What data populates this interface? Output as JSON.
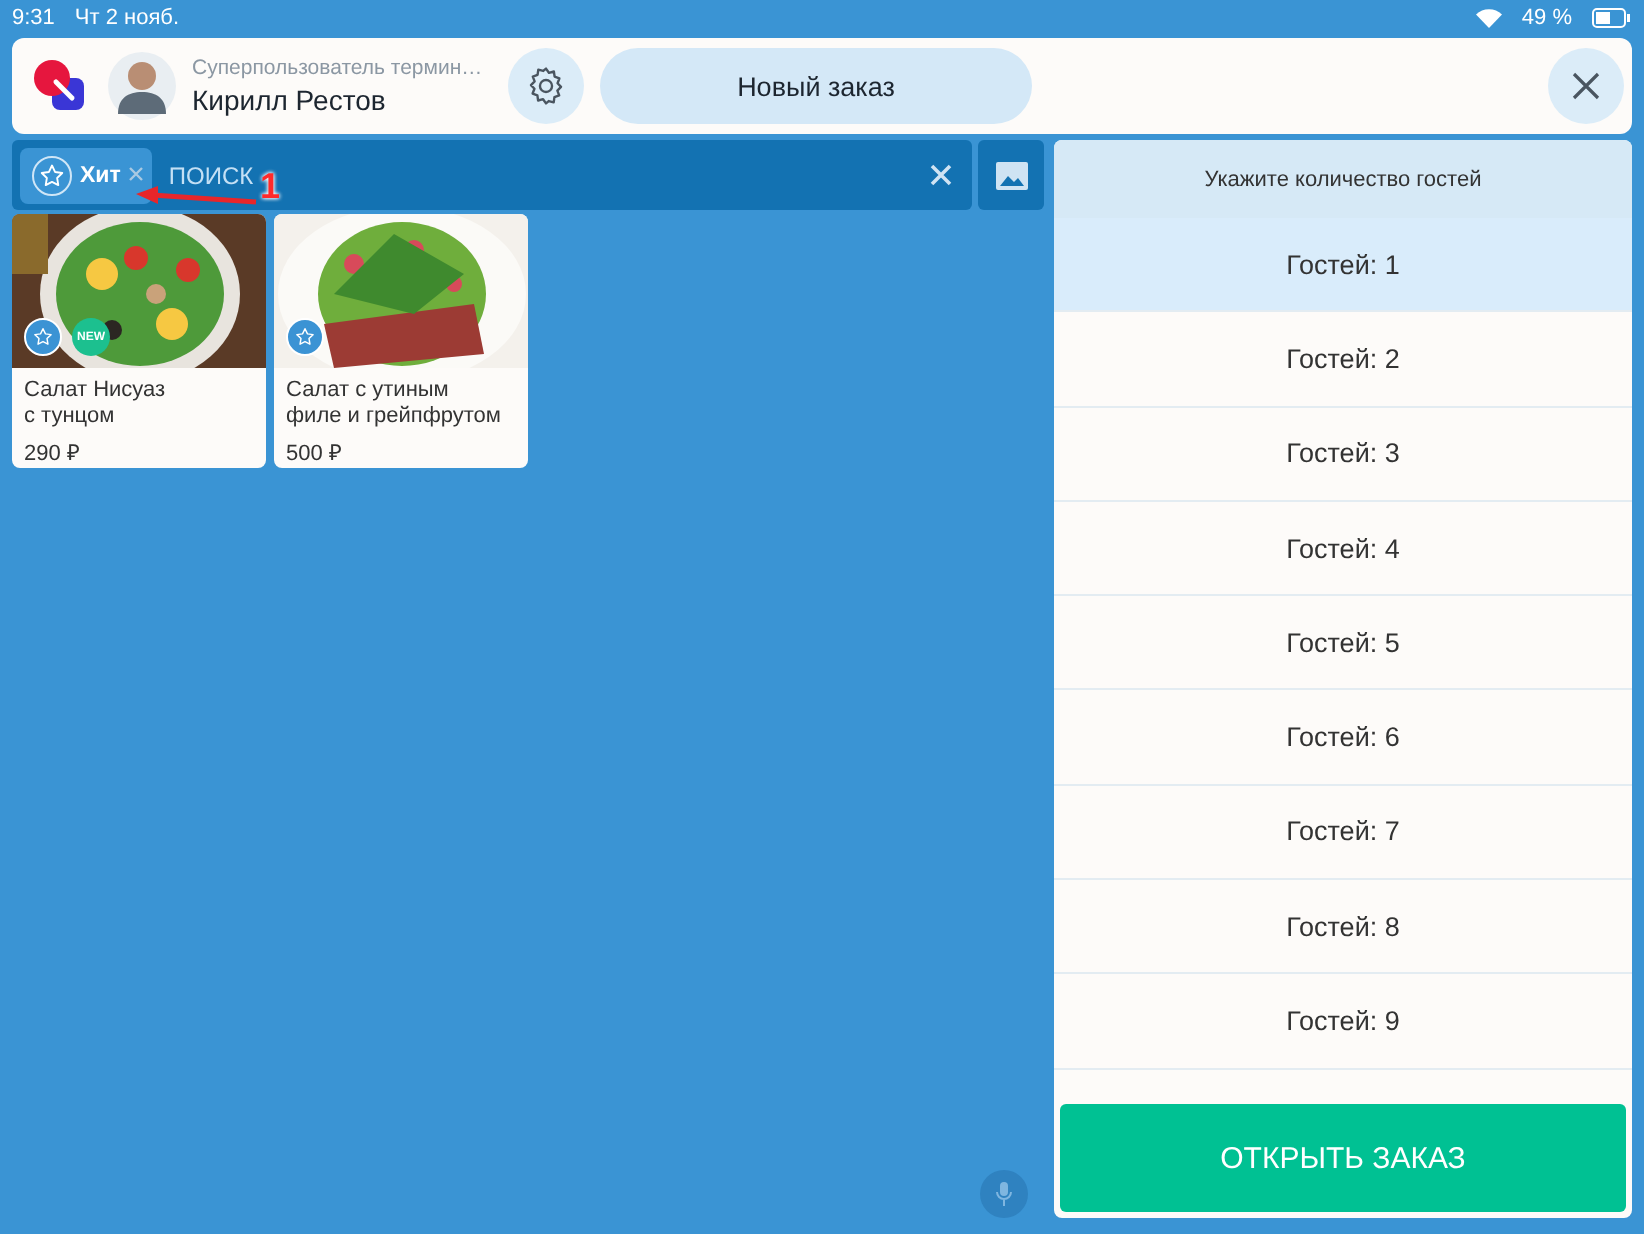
{
  "status_bar": {
    "time": "9:31",
    "date": "Чт 2 нояб.",
    "battery": "49 %"
  },
  "header": {
    "role": "Суперпользователь термин…",
    "user_name": "Кирилл Рестов",
    "new_order_button": "Новый заказ"
  },
  "search": {
    "chip": "Хит",
    "placeholder": "ПОИСК"
  },
  "annotation": {
    "number": "1"
  },
  "products": [
    {
      "name": "Салат Нисуаз\nс тунцом",
      "price": "290 ₽",
      "favorite": true,
      "new": true
    },
    {
      "name": "Салат с утиным\nфиле и грейпфрутом",
      "price": "500 ₽",
      "favorite": true,
      "new": false
    }
  ],
  "new_badge": "NEW",
  "guest_panel": {
    "title": "Укажите количество гостей",
    "options": [
      {
        "label": "Гостей: 1",
        "selected": true
      },
      {
        "label": "Гостей: 2",
        "selected": false
      },
      {
        "label": "Гостей: 3",
        "selected": false
      },
      {
        "label": "Гостей: 4",
        "selected": false
      },
      {
        "label": "Гостей: 5",
        "selected": false
      },
      {
        "label": "Гостей: 6",
        "selected": false
      },
      {
        "label": "Гостей: 7",
        "selected": false
      },
      {
        "label": "Гостей: 8",
        "selected": false
      },
      {
        "label": "Гостей: 9",
        "selected": false
      }
    ],
    "open_button": "ОТКРЫТЬ ЗАКАЗ"
  }
}
